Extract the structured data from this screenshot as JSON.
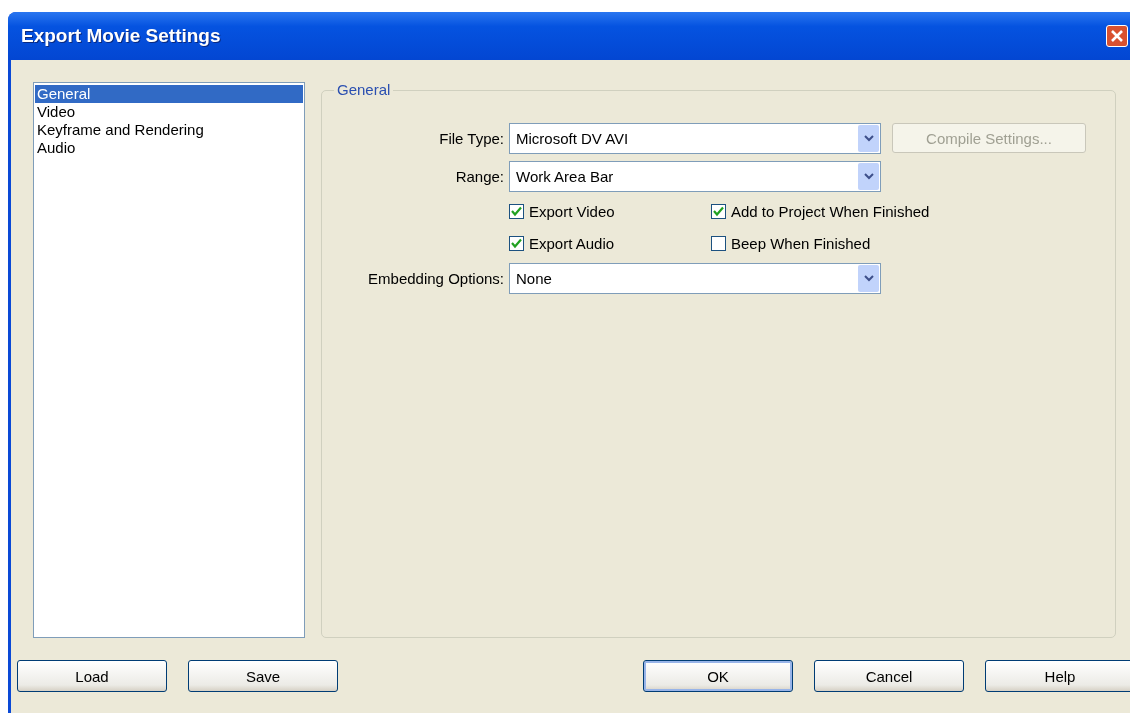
{
  "window": {
    "title": "Export Movie Settings"
  },
  "sidebar": {
    "items": [
      {
        "label": "General",
        "selected": true
      },
      {
        "label": "Video",
        "selected": false
      },
      {
        "label": "Keyframe and Rendering",
        "selected": false
      },
      {
        "label": "Audio",
        "selected": false
      }
    ]
  },
  "group": {
    "title": "General",
    "rows": [
      {
        "kind": "dropdown",
        "label": "File Type:",
        "value": "Microsoft DV AVI",
        "button": {
          "label": "Compile Settings...",
          "disabled": true
        }
      },
      {
        "kind": "dropdown",
        "label": "Range:",
        "value": "Work Area Bar"
      },
      {
        "kind": "checks",
        "checks": [
          {
            "label": "Export Video",
            "checked": true
          },
          {
            "label": "Add to Project When Finished",
            "checked": true
          }
        ]
      },
      {
        "kind": "checks",
        "checks": [
          {
            "label": "Export Audio",
            "checked": true
          },
          {
            "label": "Beep When Finished",
            "checked": false
          }
        ]
      },
      {
        "kind": "dropdown",
        "label": "Embedding Options:",
        "value": "None"
      }
    ]
  },
  "buttons_left": [
    "Load",
    "Save"
  ],
  "buttons_right": [
    {
      "label": "OK",
      "default": true
    },
    {
      "label": "Cancel",
      "default": false
    },
    {
      "label": "Help",
      "default": false
    }
  ]
}
